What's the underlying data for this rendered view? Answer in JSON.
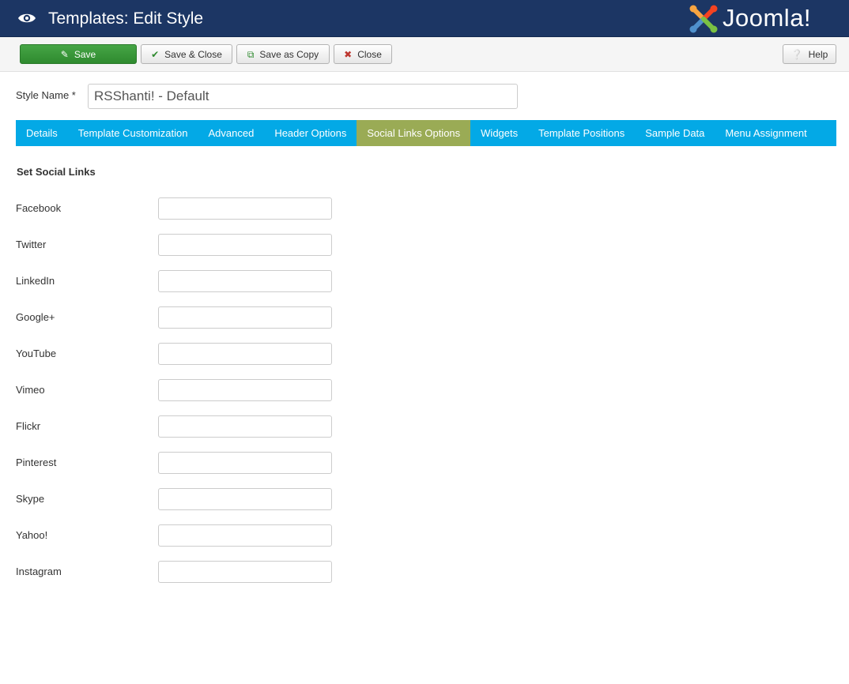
{
  "header": {
    "title": "Templates: Edit Style",
    "brand": "Joomla!",
    "eye_icon": "eye-icon"
  },
  "toolbar": {
    "save_label": "Save",
    "save_close_label": "Save & Close",
    "save_copy_label": "Save as Copy",
    "close_label": "Close",
    "help_label": "Help"
  },
  "style_name": {
    "label": "Style Name *",
    "value": "RSShanti! - Default"
  },
  "tabs": [
    {
      "label": "Details",
      "active": false
    },
    {
      "label": "Template Customization",
      "active": false
    },
    {
      "label": "Advanced",
      "active": false
    },
    {
      "label": "Header Options",
      "active": false
    },
    {
      "label": "Social Links Options",
      "active": true
    },
    {
      "label": "Widgets",
      "active": false
    },
    {
      "label": "Template Positions",
      "active": false
    },
    {
      "label": "Sample Data",
      "active": false
    },
    {
      "label": "Menu Assignment",
      "active": false
    }
  ],
  "section": {
    "title": "Set Social Links"
  },
  "fields": [
    {
      "label": "Facebook",
      "value": ""
    },
    {
      "label": "Twitter",
      "value": ""
    },
    {
      "label": "LinkedIn",
      "value": ""
    },
    {
      "label": "Google+",
      "value": ""
    },
    {
      "label": "YouTube",
      "value": ""
    },
    {
      "label": "Vimeo",
      "value": ""
    },
    {
      "label": "Flickr",
      "value": ""
    },
    {
      "label": "Pinterest",
      "value": ""
    },
    {
      "label": "Skype",
      "value": ""
    },
    {
      "label": "Yahoo!",
      "value": ""
    },
    {
      "label": "Instagram",
      "value": ""
    }
  ],
  "colors": {
    "header_bg": "#1c3664",
    "tab_bar": "#03a9e6",
    "tab_active": "#9aab55",
    "save_green": "#46a546"
  }
}
